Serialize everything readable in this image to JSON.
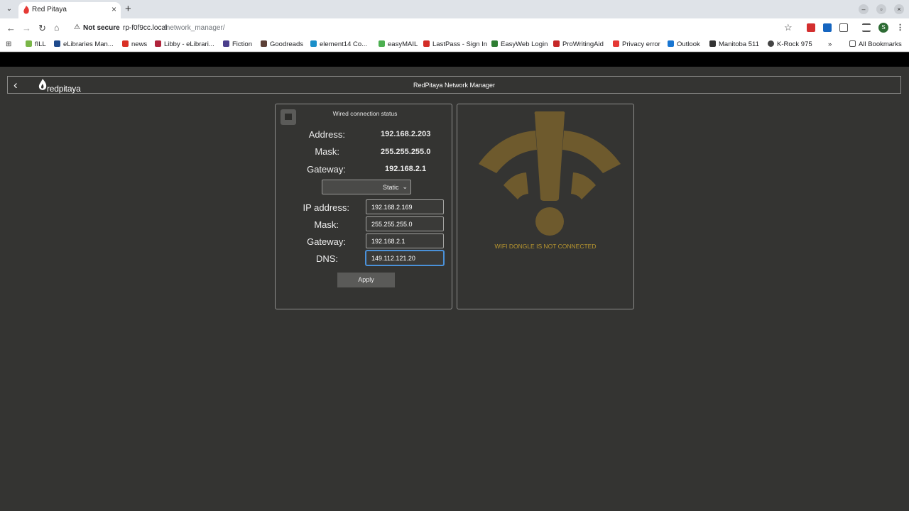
{
  "browser": {
    "tab_title": "Red Pitaya",
    "tab_close": "×",
    "new_tab": "+",
    "security_label": "Not secure",
    "url_host": "rp-f0f9cc.local",
    "url_path": "/network_manager/",
    "profile_initial": "S",
    "icons": [
      "back-arrow-icon",
      "forward-arrow-icon",
      "reload-icon",
      "home-icon",
      "warning-icon",
      "star-icon",
      "extensions-icon",
      "menu-icon"
    ]
  },
  "bookmarks": {
    "items": [
      {
        "label": "fILL",
        "color": "#7ab648"
      },
      {
        "label": "eLibraries Man...",
        "color": "#1e4a8c"
      },
      {
        "label": "news",
        "color": "#d93025"
      },
      {
        "label": "Libby - eLibrari...",
        "color": "#b0243b"
      },
      {
        "label": "Fiction",
        "color": "#4b3f8c"
      },
      {
        "label": "Goodreads",
        "color": "#5d4037"
      },
      {
        "label": "element14 Co...",
        "color": "#1b8fc9"
      },
      {
        "label": "easyMAIL",
        "color": "#4caf50"
      },
      {
        "label": "LastPass - Sign In",
        "color": "#d32d27"
      },
      {
        "label": "EasyWeb Login",
        "color": "#2e7d32"
      },
      {
        "label": "ProWritingAid",
        "color": "#c62828"
      },
      {
        "label": "Privacy error",
        "color": "#e53935"
      },
      {
        "label": "Outlook",
        "color": "#1976d2"
      },
      {
        "label": "Manitoba 511",
        "color": "#333333"
      },
      {
        "label": "K-Rock 975",
        "color": "#444444"
      }
    ],
    "overflow": "»",
    "all_bookmarks": "All Bookmarks"
  },
  "header": {
    "title": "RedPitaya Network Manager",
    "logo_text": "redpitaya",
    "back_icon": "‹"
  },
  "wired": {
    "title": "Wired connection status",
    "status": [
      {
        "label": "Address:",
        "value": "192.168.2.203"
      },
      {
        "label": "Mask:",
        "value": "255.255.255.0"
      },
      {
        "label": "Gateway:",
        "value": "192.168.2.1"
      }
    ],
    "mode": "Static",
    "fields": [
      {
        "label": "IP address:",
        "value": "192.168.2.169"
      },
      {
        "label": "Mask:",
        "value": "255.255.255.0"
      },
      {
        "label": "Gateway:",
        "value": "192.168.2.1"
      },
      {
        "label": "DNS:",
        "value": "149.112.121.20"
      }
    ],
    "apply_label": "Apply"
  },
  "wifi": {
    "message": "WIFI DONGLE IS NOT CONNECTED",
    "icon_color": "#6e5a2d",
    "message_color": "#b8962f"
  }
}
